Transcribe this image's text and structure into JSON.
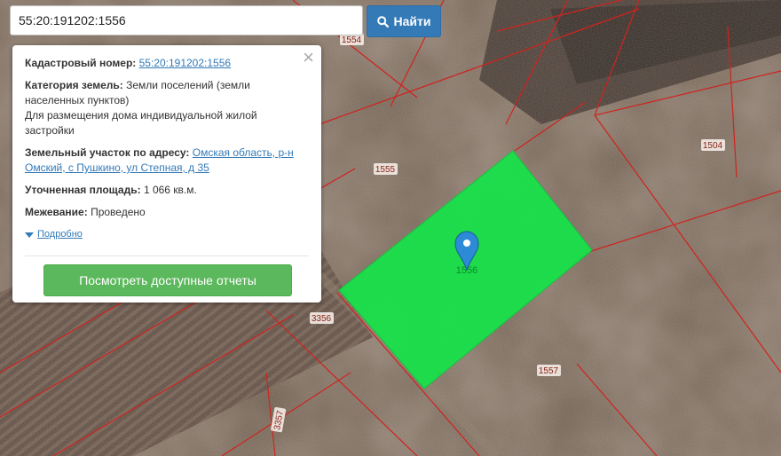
{
  "search": {
    "query": "55:20:191202:1556",
    "button_label": "Найти",
    "button_icon": "search-icon"
  },
  "info": {
    "cadastral_label": "Кадастровый номер:",
    "cadastral_value": "55:20:191202:1556",
    "category_label": "Категория земель:",
    "category_value": "Земли поселений (земли населенных пунктов)",
    "category_purpose": "Для размещения дома индивидуальной жилой застройки",
    "address_label": "Земельный участок по адресу:",
    "address_value": "Омская область, р-н Омский, с Пушкино, ул Степная, д 35",
    "area_label": "Уточненная площадь:",
    "area_value": "1 066 кв.м.",
    "survey_label": "Межевание:",
    "survey_value": "Проведено",
    "more_label": "Подробно",
    "reports_button": "Посмотреть доступные отчеты",
    "close_icon": "close-icon"
  },
  "map": {
    "selected_parcel_label": "1556",
    "parcel_labels": [
      "1554",
      "1555",
      "1504",
      "3356",
      "1557",
      "3357"
    ],
    "marker_icon": "map-pin-icon",
    "colors": {
      "parcel_fill": "#18e14a",
      "boundary": "#d0231e",
      "marker": "#2d8ad6"
    }
  }
}
